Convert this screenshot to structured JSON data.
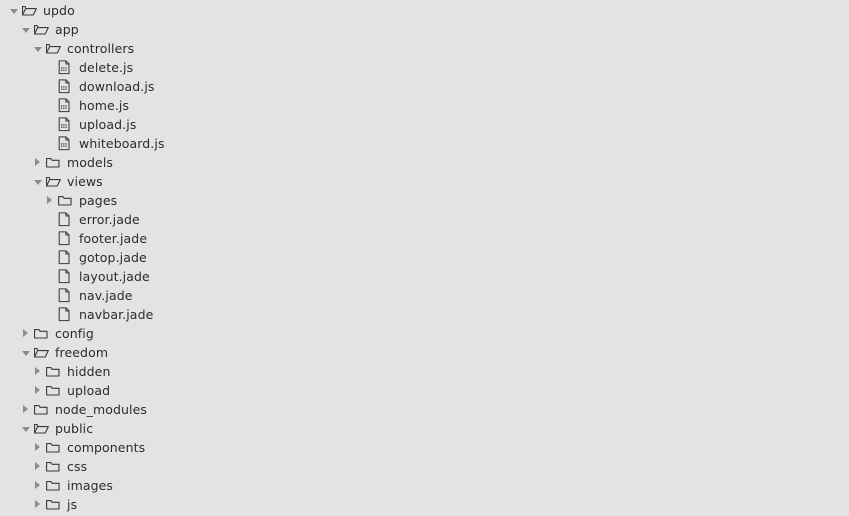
{
  "view": {
    "name": "file-explorer-tree",
    "background_color": "#e3e3e3",
    "text_color": "#2c2c2c",
    "icon_color": "#3a3a3a",
    "twisty_color": "#8c8c8c"
  },
  "tree": {
    "items": [
      {
        "label": "updo",
        "depth": 0,
        "type": "folder",
        "state": "expanded"
      },
      {
        "label": "app",
        "depth": 1,
        "type": "folder",
        "state": "expanded"
      },
      {
        "label": "controllers",
        "depth": 2,
        "type": "folder",
        "state": "expanded"
      },
      {
        "label": "delete.js",
        "depth": 3,
        "type": "file-js",
        "state": "leaf"
      },
      {
        "label": "download.js",
        "depth": 3,
        "type": "file-js",
        "state": "leaf"
      },
      {
        "label": "home.js",
        "depth": 3,
        "type": "file-js",
        "state": "leaf"
      },
      {
        "label": "upload.js",
        "depth": 3,
        "type": "file-js",
        "state": "leaf"
      },
      {
        "label": "whiteboard.js",
        "depth": 3,
        "type": "file-js",
        "state": "leaf"
      },
      {
        "label": "models",
        "depth": 2,
        "type": "folder",
        "state": "collapsed"
      },
      {
        "label": "views",
        "depth": 2,
        "type": "folder",
        "state": "expanded"
      },
      {
        "label": "pages",
        "depth": 3,
        "type": "folder",
        "state": "collapsed"
      },
      {
        "label": "error.jade",
        "depth": 3,
        "type": "file",
        "state": "leaf"
      },
      {
        "label": "footer.jade",
        "depth": 3,
        "type": "file",
        "state": "leaf"
      },
      {
        "label": "gotop.jade",
        "depth": 3,
        "type": "file",
        "state": "leaf"
      },
      {
        "label": "layout.jade",
        "depth": 3,
        "type": "file",
        "state": "leaf"
      },
      {
        "label": "nav.jade",
        "depth": 3,
        "type": "file",
        "state": "leaf"
      },
      {
        "label": "navbar.jade",
        "depth": 3,
        "type": "file",
        "state": "leaf"
      },
      {
        "label": "config",
        "depth": 1,
        "type": "folder",
        "state": "collapsed"
      },
      {
        "label": "freedom",
        "depth": 1,
        "type": "folder",
        "state": "expanded"
      },
      {
        "label": "hidden",
        "depth": 2,
        "type": "folder",
        "state": "collapsed"
      },
      {
        "label": "upload",
        "depth": 2,
        "type": "folder",
        "state": "collapsed"
      },
      {
        "label": "node_modules",
        "depth": 1,
        "type": "folder",
        "state": "collapsed"
      },
      {
        "label": "public",
        "depth": 1,
        "type": "folder",
        "state": "expanded"
      },
      {
        "label": "components",
        "depth": 2,
        "type": "folder",
        "state": "collapsed"
      },
      {
        "label": "css",
        "depth": 2,
        "type": "folder",
        "state": "collapsed"
      },
      {
        "label": "images",
        "depth": 2,
        "type": "folder",
        "state": "collapsed"
      },
      {
        "label": "js",
        "depth": 2,
        "type": "folder",
        "state": "collapsed"
      }
    ],
    "icons": {
      "folder_open": "folder-open-icon",
      "folder_closed": "folder-closed-icon",
      "file": "file-icon",
      "file_js": "file-script-icon",
      "twisty_open": "chevron-down-icon",
      "twisty_closed": "chevron-right-icon"
    }
  }
}
